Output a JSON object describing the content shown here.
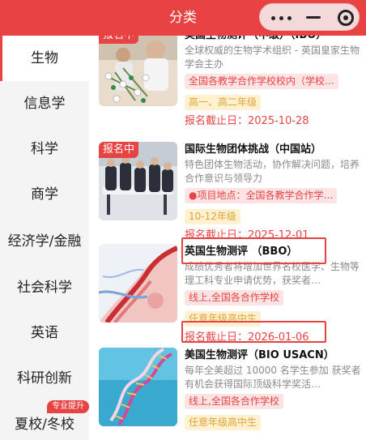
{
  "header": {
    "title": "分类"
  },
  "sidebar": {
    "items": [
      {
        "label": "生物",
        "active": true
      },
      {
        "label": "信息学"
      },
      {
        "label": "科学"
      },
      {
        "label": "商学"
      },
      {
        "label": "经济学/金融"
      },
      {
        "label": "社会科学"
      },
      {
        "label": "英语"
      },
      {
        "label": "科研创新"
      },
      {
        "label": "夏校/冬校"
      }
    ],
    "badge": "专业提升"
  },
  "cards": [
    {
      "status": "报名中",
      "title": "美国生物测评（中级）（IBO）",
      "desc": "全球权威的生物学术组织 - 英国皇家生物学会主办",
      "location": "全国各教学合作学校校内（学校…",
      "grade": "高一、高二年级",
      "deadline": "报名截止日：2025-10-28"
    },
    {
      "status": "报名中",
      "title": "国际生物团体挑战（中国站）",
      "desc": "特色团体生物活动，协作解决问题，培养合作意识与领导力",
      "location": "●项目地点：全国各教学合作学…",
      "grade": "10-12年级",
      "deadline": "报名截止日：2025-12-01"
    },
    {
      "title": "英国生物测评 （BBO）",
      "desc": "成绩优秀者将增加世界名校医学、生物等理工科专业申请优势，获奖者…",
      "location": "线上,全国各合作学校",
      "grade": "任意年级高中生",
      "deadline": "报名截止日：2026-01-06"
    },
    {
      "title": "美国生物测评（BIO USACN）",
      "desc": "每年全美超过 10000 名学生参加 获奖者有机会获得国际顶级科学奖活…",
      "location": "线上,全国各合作学校",
      "grade": "任意年级高中生"
    }
  ],
  "colors": {
    "accent": "#e84343",
    "grade_text": "#e3a33a",
    "grade_bg": "#fdf1cf",
    "loc_bg": "#fde4e4"
  }
}
